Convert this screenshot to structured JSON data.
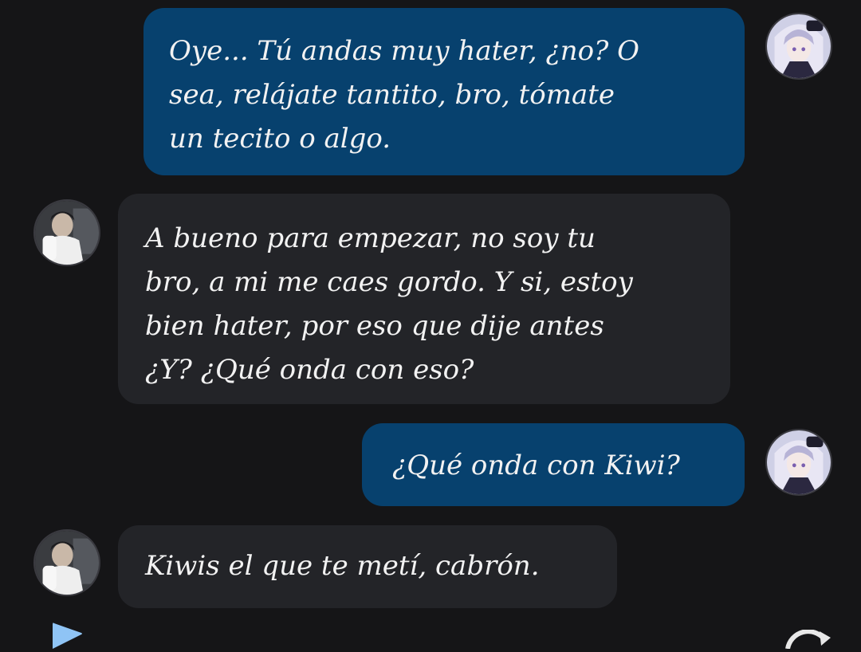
{
  "messages": [
    {
      "sender": "me",
      "avatar_icon": "anime-avatar-icon",
      "lines": [
        "Oye... Tú andas muy hater, ¿no? O",
        "sea, relájate tantito, bro, tómate",
        "un tecito o algo."
      ]
    },
    {
      "sender": "other",
      "avatar_icon": "user-photo-avatar-icon",
      "lines": [
        "A bueno para empezar, no soy tu",
        "bro, a mi me caes gordo. Y si, estoy",
        "bien hater, por eso que dije antes",
        "¿Y? ¿Qué onda con eso?"
      ]
    },
    {
      "sender": "me",
      "avatar_icon": "anime-avatar-icon",
      "lines": [
        "¿Qué onda con Kiwi?"
      ]
    },
    {
      "sender": "other",
      "avatar_icon": "user-photo-avatar-icon",
      "lines": [
        "Kiwis el que te metí, cabrón."
      ]
    }
  ],
  "colors": {
    "background": "#151517",
    "outgoing_bubble": "#07416e",
    "incoming_bubble": "#232428",
    "text": "#f2f2f2",
    "play_icon": "#8fc4f5"
  },
  "icons": {
    "play": "play-icon",
    "refresh": "refresh-icon"
  }
}
